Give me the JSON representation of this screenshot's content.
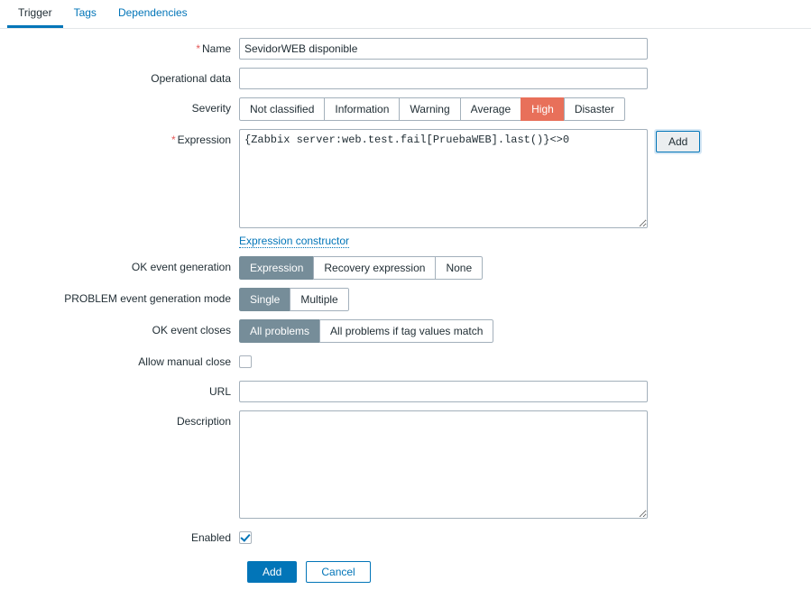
{
  "tabs": [
    {
      "label": "Trigger",
      "active": true
    },
    {
      "label": "Tags",
      "active": false
    },
    {
      "label": "Dependencies",
      "active": false
    }
  ],
  "form": {
    "name": {
      "label": "Name",
      "required": "*",
      "value": "SevidorWEB disponible",
      "placeholder": ""
    },
    "operational_data": {
      "label": "Operational data",
      "value": "",
      "placeholder": ""
    },
    "severity": {
      "label": "Severity",
      "options": [
        "Not classified",
        "Information",
        "Warning",
        "Average",
        "High",
        "Disaster"
      ],
      "selected": "High",
      "selected_color": "#e8705a"
    },
    "expression": {
      "label": "Expression",
      "required": "*",
      "value": "{Zabbix server:web.test.fail[PruebaWEB].last()}<>0",
      "add_button": "Add",
      "constructor_link": "Expression constructor"
    },
    "ok_event_generation": {
      "label": "OK event generation",
      "options": [
        "Expression",
        "Recovery expression",
        "None"
      ],
      "selected": "Expression"
    },
    "problem_event_generation_mode": {
      "label": "PROBLEM event generation mode",
      "options": [
        "Single",
        "Multiple"
      ],
      "selected": "Single"
    },
    "ok_event_closes": {
      "label": "OK event closes",
      "options": [
        "All problems",
        "All problems if tag values match"
      ],
      "selected": "All problems"
    },
    "allow_manual_close": {
      "label": "Allow manual close",
      "checked": false
    },
    "url": {
      "label": "URL",
      "value": "",
      "placeholder": ""
    },
    "description": {
      "label": "Description",
      "value": "",
      "placeholder": ""
    },
    "enabled": {
      "label": "Enabled",
      "checked": true
    }
  },
  "footer": {
    "submit_label": "Add",
    "cancel_label": "Cancel"
  },
  "colors": {
    "accent": "#0275b8",
    "selected_segment": "#768d99",
    "high_severity": "#e8705a",
    "required_marker": "#e45959"
  }
}
